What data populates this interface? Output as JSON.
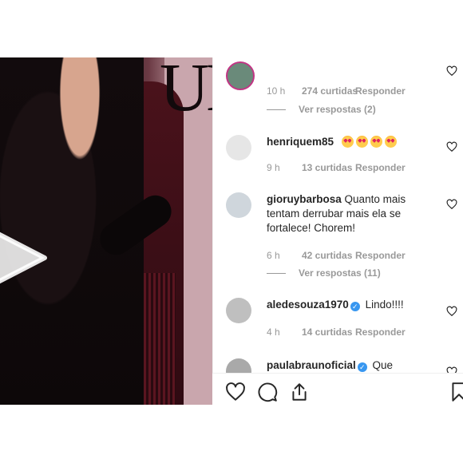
{
  "media": {
    "logo_fragment": "UE",
    "play_icon": "play-icon"
  },
  "comments": [
    {
      "username": "",
      "text": "",
      "time": "10 h",
      "likes": "274 curtidas",
      "reply": "Responder",
      "view_replies": "Ver respostas (2)"
    },
    {
      "username": "henriquem85",
      "verified": false,
      "text": "",
      "emoji_count": 4,
      "time": "9 h",
      "likes": "13 curtidas",
      "reply": "Responder"
    },
    {
      "username": "gioruybarbosa",
      "verified": false,
      "text": "Quanto mais tentam derrubar mais ela se fortalece! Chorem!",
      "time": "6 h",
      "likes": "42 curtidas",
      "reply": "Responder",
      "view_replies": "Ver respostas (11)"
    },
    {
      "username": "aledesouza1970",
      "verified": true,
      "text": "Lindo!!!!",
      "time": "4 h",
      "likes": "14 curtidas",
      "reply": "Responder"
    },
    {
      "username": "paulabraunoficial",
      "verified": true,
      "text": "Que"
    }
  ],
  "actions": {
    "like": "heart-icon",
    "comment": "comment-icon",
    "share": "share-icon",
    "save": "bookmark-icon"
  },
  "colors": {
    "text": "#262626",
    "muted": "#999999",
    "verified": "#3897f0",
    "divider": "#efefef"
  }
}
